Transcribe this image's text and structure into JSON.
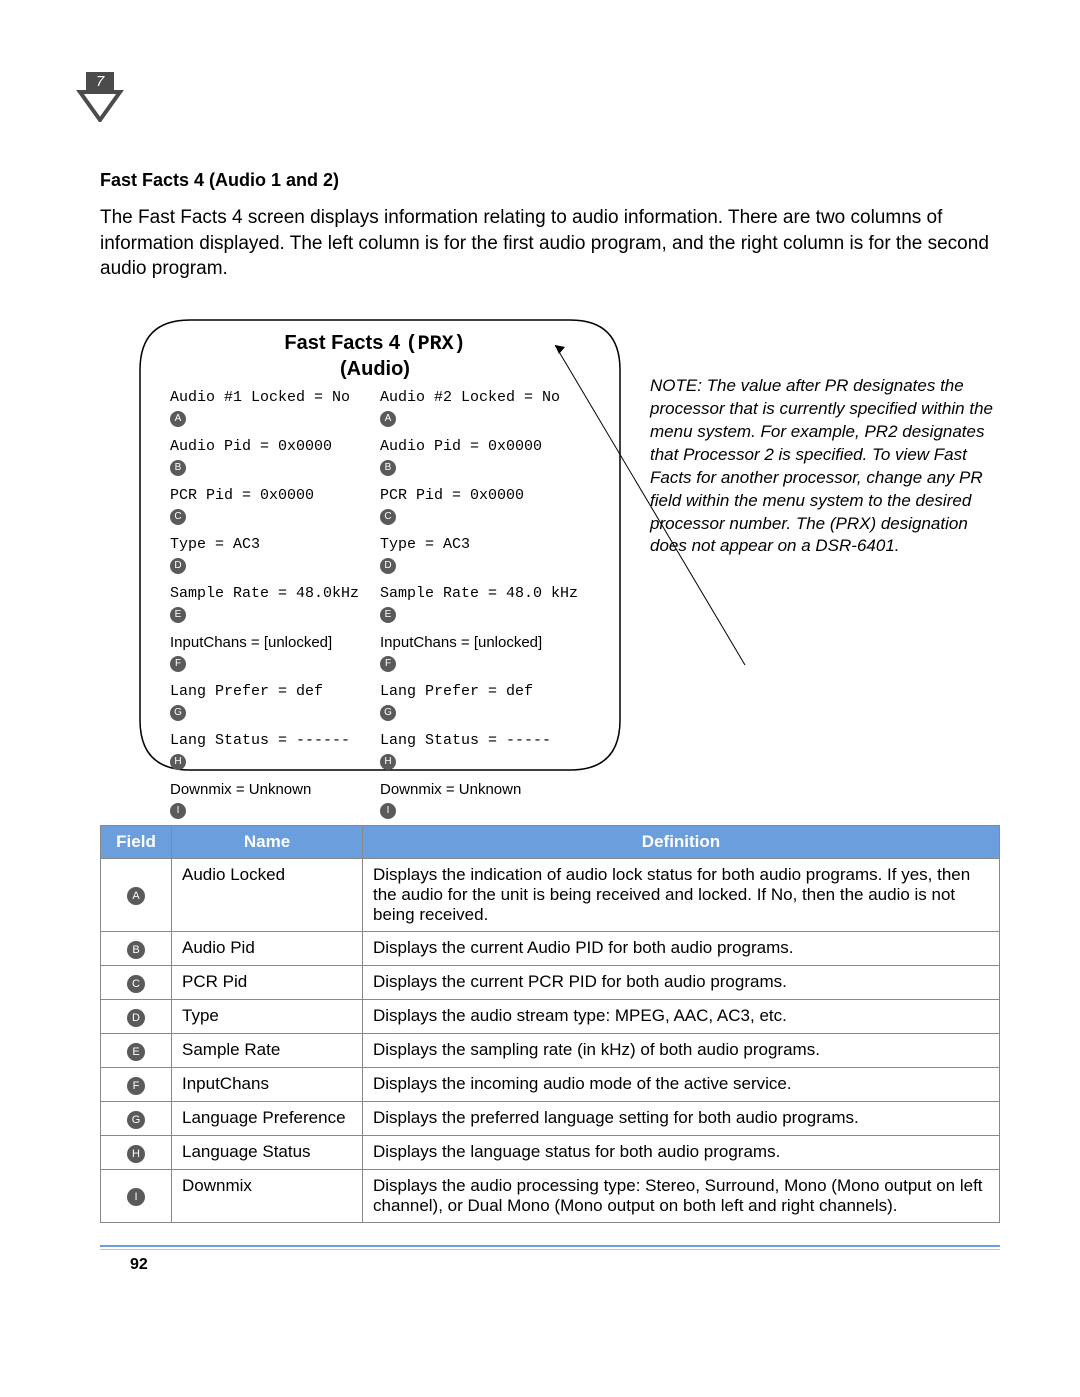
{
  "chapter_badge": "7",
  "section_title": "Fast Facts 4 (Audio 1 and 2)",
  "intro": "The Fast Facts 4 screen displays information relating to audio information. There are two columns of information displayed. The left column is for the first audio program, and the right column is for the second audio program.",
  "screen": {
    "title_prefix": "Fast Facts 4 ",
    "title_mono": "(PRX)",
    "subtitle": "(Audio)",
    "cols": [
      {
        "locked": "Audio #1 Locked = No",
        "audio_pid": "Audio Pid = 0x0000",
        "pcr_pid": "PCR Pid = 0x0000",
        "type": "Type = AC3",
        "sample": "Sample Rate = 48.0kHz",
        "input": "InputChans = [unlocked]",
        "langpref": "Lang Prefer = def",
        "langstat": "Lang Status = ------",
        "downmix": "Downmix = Unknown"
      },
      {
        "locked": "Audio #2 Locked = No",
        "audio_pid": "Audio Pid = 0x0000",
        "pcr_pid": "PCR Pid = 0x0000",
        "type": "Type = AC3",
        "sample": "Sample Rate = 48.0 kHz",
        "input": "InputChans = [unlocked]",
        "langpref": "Lang Prefer = def",
        "langstat": "Lang Status = -----",
        "downmix": "Downmix = Unknown"
      }
    ],
    "markers": [
      "A",
      "B",
      "C",
      "D",
      "E",
      "F",
      "G",
      "H",
      "I"
    ]
  },
  "note": "NOTE: The value after PR designates the processor that is currently specified within the menu system. For example, PR2 designates that Processor 2 is specified. To view Fast Facts for another processor, change any PR field within the menu system to the desired processor number. The (PRX) designation does not appear on a DSR-6401.",
  "table": {
    "headers": {
      "field": "Field",
      "name": "Name",
      "def": "Definition"
    },
    "rows": [
      {
        "m": "A",
        "name": "Audio Locked",
        "def": "Displays the indication of audio lock status for both audio programs. If yes, then the audio for the unit is being received and locked. If No, then the audio is not being received."
      },
      {
        "m": "B",
        "name": "Audio Pid",
        "def": "Displays the current Audio PID for both audio programs."
      },
      {
        "m": "C",
        "name": "PCR Pid",
        "def": "Displays the current PCR PID for both audio programs."
      },
      {
        "m": "D",
        "name": "Type",
        "def": "Displays the audio stream type: MPEG, AAC, AC3, etc."
      },
      {
        "m": "E",
        "name": "Sample Rate",
        "def": "Displays the sampling rate (in kHz) of both audio programs."
      },
      {
        "m": "F",
        "name": "InputChans",
        "def": "Displays the incoming audio mode of the active service."
      },
      {
        "m": "G",
        "name": "Language Preference",
        "def": "Displays the preferred language setting for both audio programs."
      },
      {
        "m": "H",
        "name": "Language Status",
        "def": "Displays the language status for both audio programs."
      },
      {
        "m": "I",
        "name": "Downmix",
        "def": "Displays the audio processing type: Stereo, Surround, Mono (Mono output on left channel), or Dual Mono (Mono output on both left and right channels)."
      }
    ]
  },
  "page_number": "92"
}
